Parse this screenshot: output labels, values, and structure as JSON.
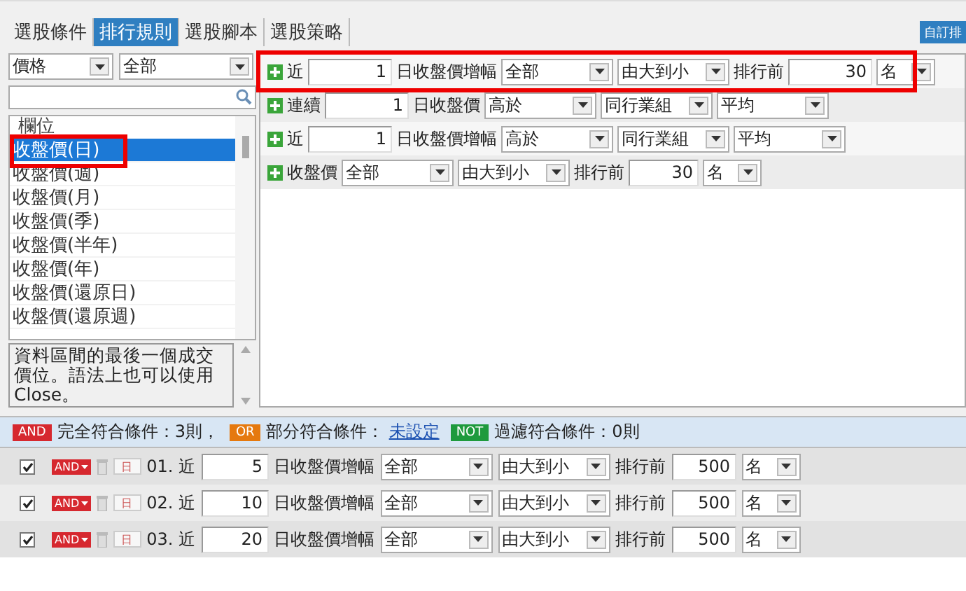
{
  "tabs": [
    {
      "label": "選股條件",
      "selected": false
    },
    {
      "label": "排行規則",
      "selected": true
    },
    {
      "label": "選股腳本",
      "selected": false
    },
    {
      "label": "選股策略",
      "selected": false
    }
  ],
  "custom_button": "自訂排",
  "field_filter": {
    "category": "價格",
    "scope": "全部"
  },
  "field_list": {
    "header": "欄位",
    "items": [
      {
        "label": "收盤價(日)",
        "selected": true,
        "highlighted": true
      },
      {
        "label": "收盤價(週)",
        "selected": false,
        "highlighted": false
      },
      {
        "label": "收盤價(月)",
        "selected": false,
        "highlighted": false
      },
      {
        "label": "收盤價(季)",
        "selected": false,
        "highlighted": false
      },
      {
        "label": "收盤價(半年)",
        "selected": false,
        "highlighted": false
      },
      {
        "label": "收盤價(年)",
        "selected": false,
        "highlighted": false
      },
      {
        "label": "收盤價(還原日)",
        "selected": false,
        "highlighted": false
      },
      {
        "label": "收盤價(還原週)",
        "selected": false,
        "highlighted": false
      }
    ]
  },
  "description": "資料區間的最後一個成交價位。語法上也可以使用Close。",
  "rules": [
    {
      "highlighted": true,
      "parts": [
        {
          "kind": "text",
          "text": "近"
        },
        {
          "kind": "input",
          "text": "1"
        },
        {
          "kind": "text",
          "text": "日收盤價增幅"
        },
        {
          "kind": "select",
          "text": "全部"
        },
        {
          "kind": "select",
          "text": "由大到小"
        },
        {
          "kind": "text",
          "text": "排行前"
        },
        {
          "kind": "input",
          "text": "30"
        },
        {
          "kind": "select",
          "text": "名"
        }
      ]
    },
    {
      "highlighted": false,
      "parts": [
        {
          "kind": "text",
          "text": "連續"
        },
        {
          "kind": "input",
          "text": "1"
        },
        {
          "kind": "text",
          "text": "日收盤價"
        },
        {
          "kind": "select",
          "text": "高於"
        },
        {
          "kind": "select",
          "text": "同行業組"
        },
        {
          "kind": "select",
          "text": "平均"
        }
      ]
    },
    {
      "highlighted": false,
      "parts": [
        {
          "kind": "text",
          "text": "近"
        },
        {
          "kind": "input",
          "text": "1"
        },
        {
          "kind": "text",
          "text": "日收盤價增幅"
        },
        {
          "kind": "select",
          "text": "高於"
        },
        {
          "kind": "select",
          "text": "同行業組"
        },
        {
          "kind": "select",
          "text": "平均"
        }
      ]
    },
    {
      "highlighted": false,
      "parts": [
        {
          "kind": "text",
          "text": "收盤價"
        },
        {
          "kind": "select",
          "text": "全部"
        },
        {
          "kind": "select",
          "text": "由大到小"
        },
        {
          "kind": "text",
          "text": "排行前"
        },
        {
          "kind": "input",
          "text": "30"
        },
        {
          "kind": "select",
          "text": "名"
        }
      ]
    }
  ],
  "summary": [
    {
      "kind": "and",
      "badge": "AND",
      "text": "完全符合條件：3則，"
    },
    {
      "kind": "or",
      "badge": "OR",
      "text": "部分符合條件：",
      "link": "未設定"
    },
    {
      "kind": "not",
      "badge": "NOT",
      "text": "過濾符合條件：0則"
    }
  ],
  "conditions": [
    {
      "checked": true,
      "logic": "AND",
      "unit": "日",
      "parts": [
        {
          "kind": "text",
          "text": "01. 近"
        },
        {
          "kind": "input",
          "text": "5"
        },
        {
          "kind": "text",
          "text": "日收盤價增幅"
        },
        {
          "kind": "select",
          "text": "全部"
        },
        {
          "kind": "select",
          "text": "由大到小"
        },
        {
          "kind": "text",
          "text": "排行前"
        },
        {
          "kind": "input",
          "text": "500"
        },
        {
          "kind": "select",
          "text": "名"
        }
      ]
    },
    {
      "checked": true,
      "logic": "AND",
      "unit": "日",
      "parts": [
        {
          "kind": "text",
          "text": "02. 近"
        },
        {
          "kind": "input",
          "text": "10"
        },
        {
          "kind": "text",
          "text": "日收盤價增幅"
        },
        {
          "kind": "select",
          "text": "全部"
        },
        {
          "kind": "select",
          "text": "由大到小"
        },
        {
          "kind": "text",
          "text": "排行前"
        },
        {
          "kind": "input",
          "text": "500"
        },
        {
          "kind": "select",
          "text": "名"
        }
      ]
    },
    {
      "checked": true,
      "logic": "AND",
      "unit": "日",
      "parts": [
        {
          "kind": "text",
          "text": "03. 近"
        },
        {
          "kind": "input",
          "text": "20"
        },
        {
          "kind": "text",
          "text": "日收盤價增幅"
        },
        {
          "kind": "select",
          "text": "全部"
        },
        {
          "kind": "select",
          "text": "由大到小"
        },
        {
          "kind": "text",
          "text": "排行前"
        },
        {
          "kind": "input",
          "text": "500"
        },
        {
          "kind": "select",
          "text": "名"
        }
      ]
    }
  ]
}
